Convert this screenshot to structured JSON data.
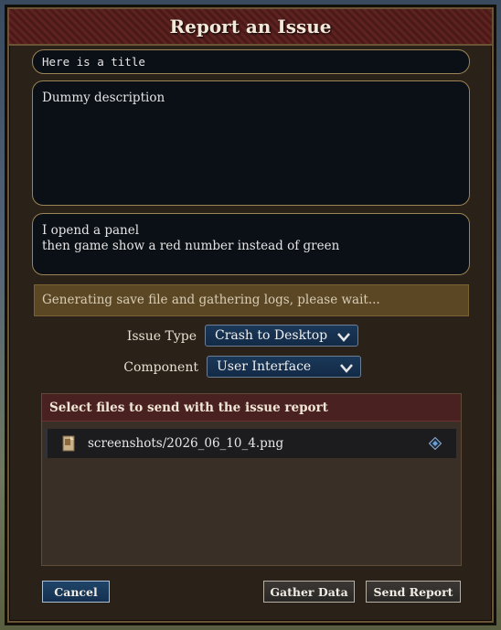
{
  "dialog": {
    "title": "Report an Issue"
  },
  "form": {
    "title_value": "Here is a title",
    "description_value": "Dummy description",
    "repro_lines": [
      "I opend a panel",
      "then game show a red number instead of green"
    ]
  },
  "status": {
    "text": "Generating save file and gathering logs, please wait..."
  },
  "issue_type": {
    "label": "Issue Type",
    "value": "Crash to Desktop"
  },
  "component": {
    "label": "Component",
    "value": "User Interface"
  },
  "files": {
    "header": "Select files to send with the issue report",
    "items": [
      {
        "name": "screenshots/2026_06_10_4.png",
        "icon": "image-file-icon"
      }
    ]
  },
  "buttons": {
    "cancel": "Cancel",
    "gather": "Gather Data",
    "send": "Send Report"
  },
  "colors": {
    "accent_blue": "#1b3859",
    "title_red": "#5e2220",
    "status_gold": "#5b4723"
  }
}
